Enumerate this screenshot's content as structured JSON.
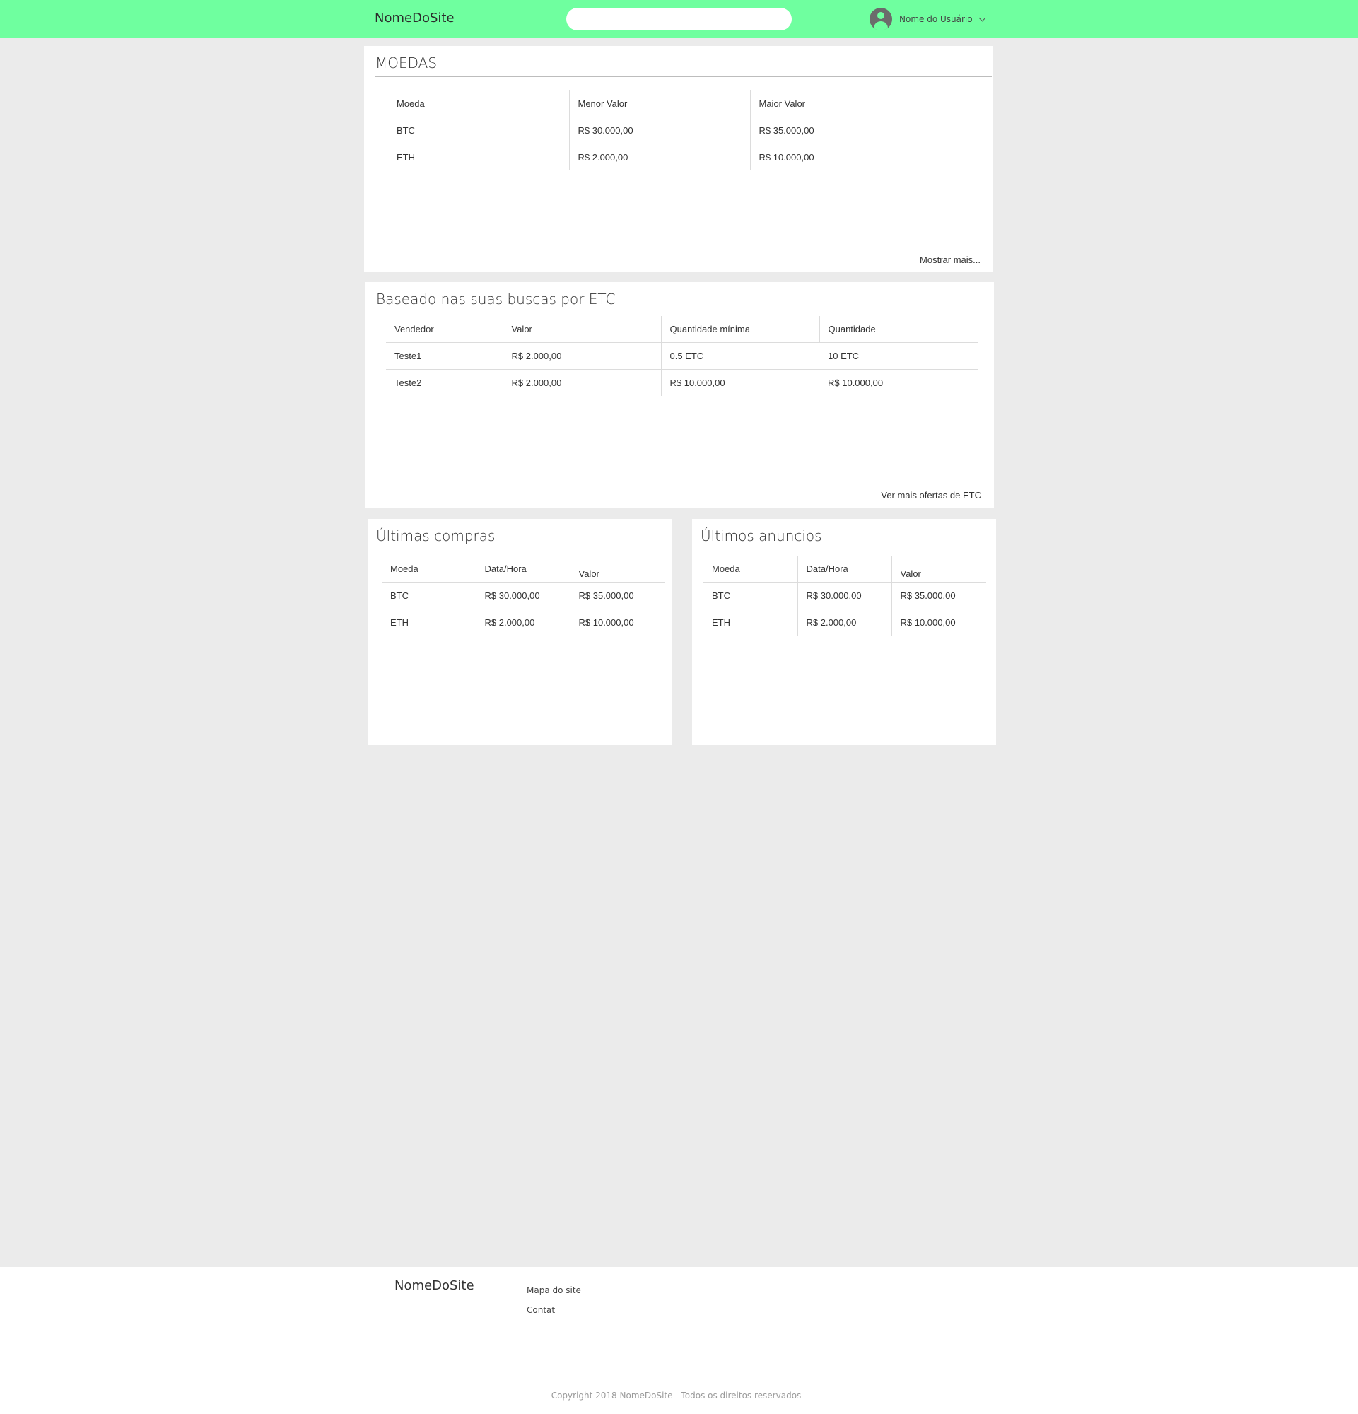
{
  "header": {
    "brand": "NomeDoSite",
    "search_value": "",
    "user_name": "Nome do Usuário",
    "background": "#6fff9f"
  },
  "moedas": {
    "title": "MOEDAS",
    "columns": [
      "Moeda",
      "Menor Valor",
      "Maior Valor"
    ],
    "rows": [
      [
        "BTC",
        "R$ 30.000,00",
        "R$ 35.000,00"
      ],
      [
        "ETH",
        "R$ 2.000,00",
        "R$ 10.000,00"
      ]
    ],
    "link": "Mostrar mais..."
  },
  "buscas": {
    "title": "Baseado nas suas buscas por ETC",
    "columns": [
      "Vendedor",
      "Valor",
      "Quantidade mínima",
      "Quantidade"
    ],
    "rows": [
      [
        "Teste1",
        "R$ 2.000,00",
        "0.5 ETC",
        "10 ETC"
      ],
      [
        "Teste2",
        "R$ 2.000,00",
        "R$ 10.000,00",
        "R$ 10.000,00"
      ]
    ],
    "link": "Ver mais ofertas de ETC"
  },
  "compras": {
    "title": "Últimas compras",
    "columns": [
      "Moeda",
      "Data/Hora",
      "Valor"
    ],
    "rows": [
      [
        "BTC",
        "R$ 30.000,00",
        "R$ 35.000,00"
      ],
      [
        "ETH",
        "R$ 2.000,00",
        "R$ 10.000,00"
      ]
    ]
  },
  "anuncios": {
    "title": "Últimos anuncios",
    "columns": [
      "Moeda",
      "Data/Hora",
      "Valor"
    ],
    "rows": [
      [
        "BTC",
        "R$ 30.000,00",
        "R$ 35.000,00"
      ],
      [
        "ETH",
        "R$ 2.000,00",
        "R$ 10.000,00"
      ]
    ]
  },
  "footer": {
    "brand": "NomeDoSite",
    "links": [
      "Mapa do site",
      "Contat"
    ],
    "copyright": "Copyright 2018 NomeDoSite - Todos os direitos reservados"
  }
}
